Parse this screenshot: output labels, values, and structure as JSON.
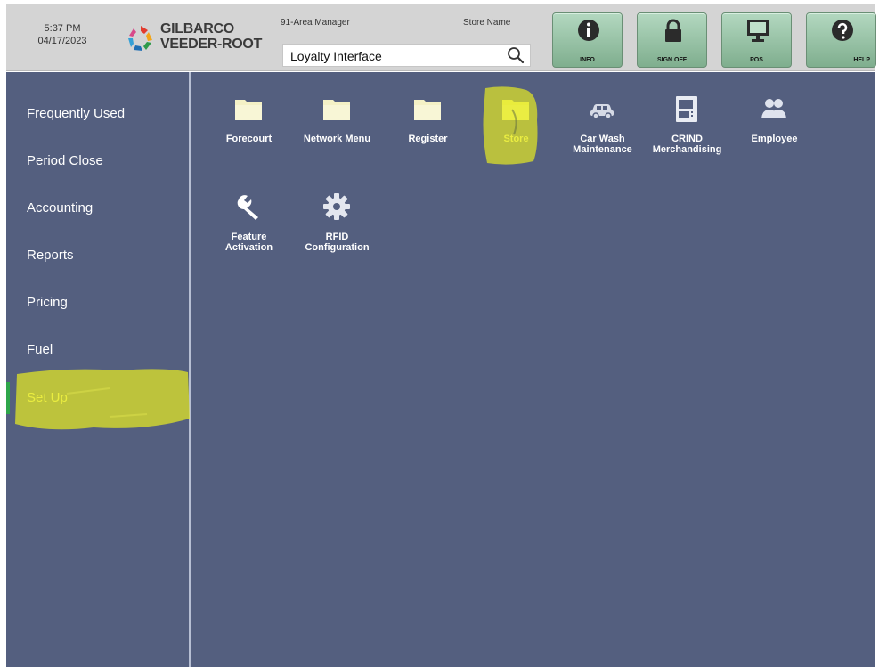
{
  "header": {
    "time": "5:37 PM",
    "date": "04/17/2023",
    "brand_line1": "GILBARCO",
    "brand_line2": "VEEDER-ROOT",
    "user": "91-Area Manager",
    "store_label": "Store Name",
    "search_value": "Loyalty Interface",
    "search_icon": "search-icon"
  },
  "toolbar": [
    {
      "label": "INFO",
      "icon": "info-icon"
    },
    {
      "label": "SIGN OFF",
      "icon": "lock-icon"
    },
    {
      "label": "POS",
      "icon": "monitor-icon"
    },
    {
      "label": "HELP",
      "icon": "question-icon"
    }
  ],
  "sidebar": {
    "items": [
      {
        "label": "Frequently Used"
      },
      {
        "label": "Period Close"
      },
      {
        "label": "Accounting"
      },
      {
        "label": "Reports"
      },
      {
        "label": "Pricing"
      },
      {
        "label": "Fuel"
      },
      {
        "label": "Set Up",
        "active": true
      }
    ]
  },
  "tiles": [
    {
      "label1": "Forecourt",
      "label2": "",
      "icon": "folder-icon"
    },
    {
      "label1": "Network Menu",
      "label2": "",
      "icon": "folder-icon"
    },
    {
      "label1": "Register",
      "label2": "",
      "icon": "folder-icon"
    },
    {
      "label1": "Store",
      "label2": "",
      "icon": "folder-icon",
      "active": true
    },
    {
      "label1": "Car Wash",
      "label2": "Maintenance",
      "icon": "car-icon"
    },
    {
      "label1": "CRIND",
      "label2": "Merchandising",
      "icon": "dispenser-icon"
    },
    {
      "label1": "Employee",
      "label2": "",
      "icon": "people-icon"
    },
    {
      "label1": "Feature",
      "label2": "Activation",
      "icon": "wrench-icon"
    },
    {
      "label1": "RFID",
      "label2": "Configuration",
      "icon": "gear-icon"
    }
  ],
  "colors": {
    "panel": "#545f7f",
    "header": "#d4d4d4",
    "highlight": "#e6ea22",
    "active_text": "#f4f48a",
    "button_green": "#9cc8aa"
  }
}
